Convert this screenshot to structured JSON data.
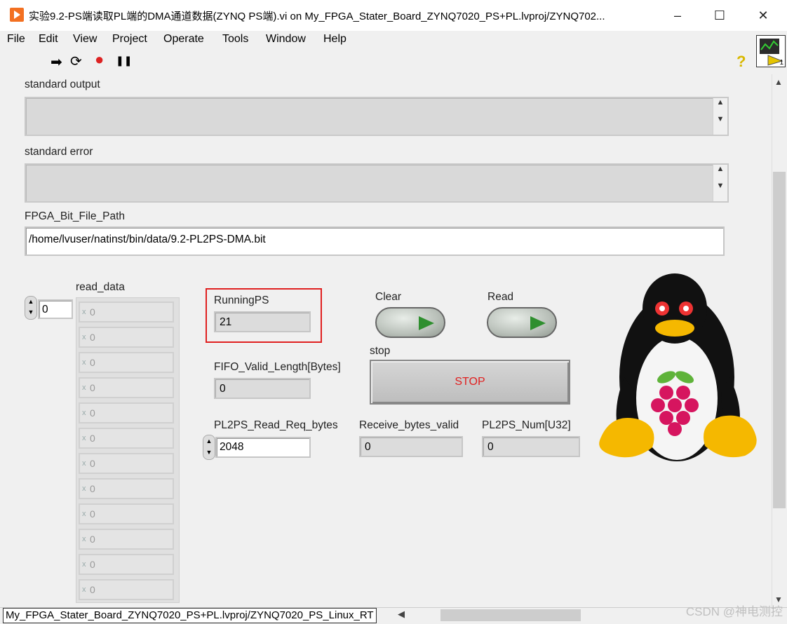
{
  "window": {
    "title": "实验9.2-PS端读取PL端的DMA通道数据(ZYNQ PS端).vi on My_FPGA_Stater_Board_ZYNQ7020_PS+PL.lvproj/ZYNQ702...",
    "minimize": "–",
    "maximize": "☐",
    "close": "✕"
  },
  "menu": [
    "File",
    "Edit",
    "View",
    "Project",
    "Operate",
    "Tools",
    "Window",
    "Help"
  ],
  "toolbar": {
    "run_icon": "➡",
    "run_continuous_icon": "⟳",
    "abort_icon": "●",
    "pause_icon": "❚❚",
    "help_icon": "?"
  },
  "vi_icon_number": "1",
  "panel": {
    "standard_output_label": "standard output",
    "standard_error_label": "standard error",
    "fpga_bit_file_path_label": "FPGA_Bit_File_Path",
    "fpga_bit_file_path_value": "/home/lvuser/natinst/bin/data/9.2-PL2PS-DMA.bit",
    "read_data_label": "read_data",
    "read_data_index": "0",
    "read_data_values": [
      "0",
      "0",
      "0",
      "0",
      "0",
      "0",
      "0",
      "0",
      "0",
      "0",
      "0",
      "0"
    ],
    "running_ps_label": "RunningPS",
    "running_ps_value": "21",
    "fifo_valid_length_label": "FIFO_Valid_Length[Bytes]",
    "fifo_valid_length_value": "0",
    "pl2ps_read_req_bytes_label": "PL2PS_Read_Req_bytes",
    "pl2ps_read_req_bytes_value": "2048",
    "receive_bytes_valid_label": "Receive_bytes_valid",
    "receive_bytes_valid_value": "0",
    "pl2ps_num_label": "PL2PS_Num[U32]",
    "pl2ps_num_value": "0",
    "clear_label": "Clear",
    "read_label": "Read",
    "stop_label": "stop",
    "stop_button_text": "STOP"
  },
  "status_bar": {
    "path": "My_FPGA_Stater_Board_ZYNQ7020_PS+PL.lvproj/ZYNQ7020_PS_Linux_RT"
  },
  "watermark": "CSDN @神电测控",
  "colors": {
    "highlight_box": "#e02020",
    "stop_text": "#e02020",
    "led_green": "#2f8f2f"
  }
}
